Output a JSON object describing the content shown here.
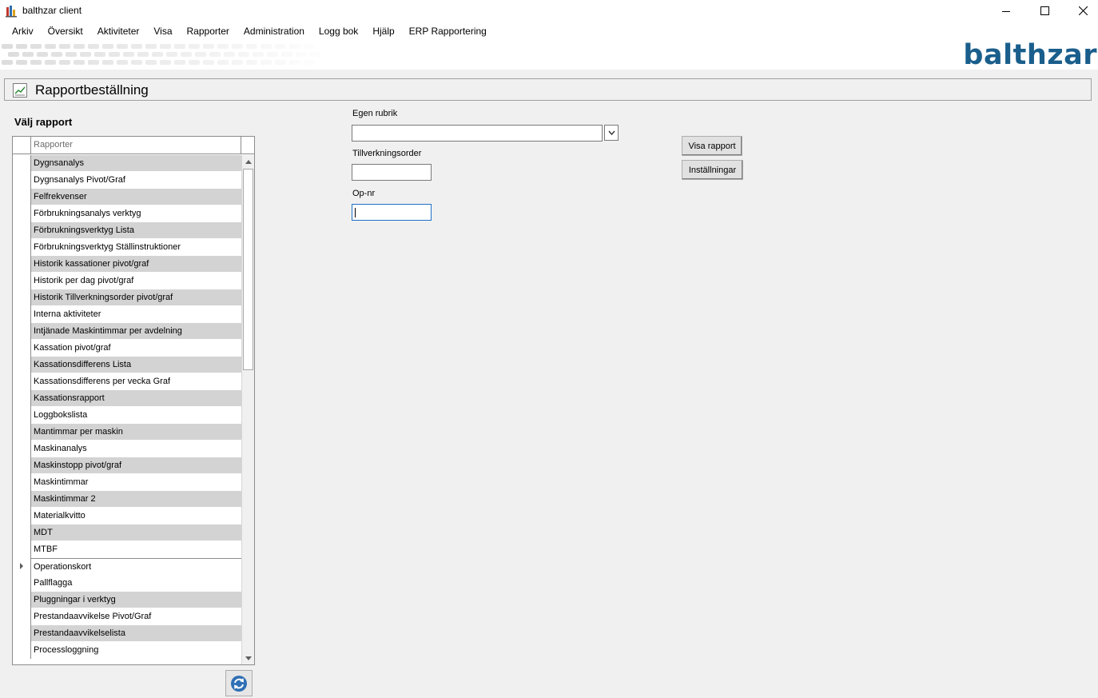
{
  "window": {
    "title": "balthzar client",
    "minimize_icon": "minimize-icon",
    "maximize_icon": "maximize-icon",
    "close_icon": "close-icon"
  },
  "menu": {
    "items": [
      "Arkiv",
      "Översikt",
      "Aktiviteter",
      "Visa",
      "Rapporter",
      "Administration",
      "Logg bok",
      "Hjälp",
      "ERP Rapportering"
    ]
  },
  "banner": {
    "logo_text": "balthzar",
    "logo_color": "#1a5e8c"
  },
  "header": {
    "title": "Rapportbeställning",
    "icon": "chart-icon"
  },
  "report_select": {
    "section_label": "Välj rapport",
    "column_header": "Rapporter",
    "current_row_index": 24,
    "rows": [
      "Dygnsanalys",
      "Dygnsanalys Pivot/Graf",
      "Felfrekvenser",
      "Förbrukningsanalys verktyg",
      "Förbrukningsverktyg Lista",
      "Förbrukningsverktyg Ställinstruktioner",
      "Historik kassationer pivot/graf",
      "Historik per dag pivot/graf",
      "Historik Tillverkningsorder pivot/graf",
      "Interna aktiviteter",
      "Intjänade Maskintimmar per avdelning",
      "Kassation pivot/graf",
      "Kassationsdifferens Lista",
      "Kassationsdifferens per vecka Graf",
      "Kassationsrapport",
      "Loggbokslista",
      "Mantimmar per maskin",
      "Maskinanalys",
      "Maskinstopp pivot/graf",
      "Maskintimmar",
      "Maskintimmar 2",
      "Materialkvitto",
      "MDT",
      "MTBF",
      "Operationskort",
      "Pallflagga",
      "Pluggningar i verktyg",
      "Prestandaavvikelse Pivot/Graf",
      "Prestandaavvikelselista",
      "Processloggning"
    ],
    "refresh_icon": "refresh-icon"
  },
  "form": {
    "egen_rubrik_label": "Egen rubrik",
    "egen_rubrik_value": "",
    "tillverkningsorder_label": "Tillverkningsorder",
    "tillverkningsorder_value": "",
    "op_nr_label": "Op-nr",
    "op_nr_value": ""
  },
  "actions": {
    "visa_rapport": "Visa rapport",
    "installningar": "Inställningar"
  }
}
